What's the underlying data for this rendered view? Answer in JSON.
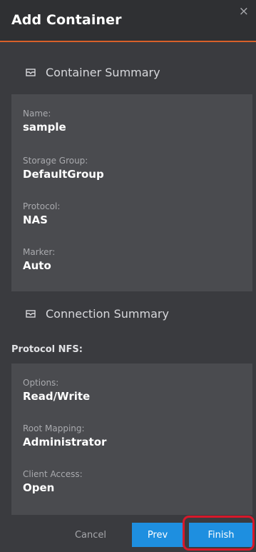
{
  "dialog": {
    "title": "Add Container",
    "close_symbol": "×"
  },
  "container_summary": {
    "heading": "Container Summary",
    "icon": "envelope-icon",
    "fields": [
      {
        "label": "Name:",
        "value": "sample"
      },
      {
        "label": "Storage Group:",
        "value": "DefaultGroup"
      },
      {
        "label": "Protocol:",
        "value": "NAS"
      },
      {
        "label": "Marker:",
        "value": "Auto"
      }
    ]
  },
  "connection_summary": {
    "heading": "Connection Summary",
    "icon": "envelope-icon",
    "protocol_title": "Protocol NFS:",
    "fields": [
      {
        "label": "Options:",
        "value": "Read/Write"
      },
      {
        "label": "Root Mapping:",
        "value": "Administrator"
      },
      {
        "label": "Client Access:",
        "value": "Open"
      }
    ]
  },
  "footer": {
    "cancel_label": "Cancel",
    "prev_label": "Prev",
    "finish_label": "Finish"
  },
  "colors": {
    "accent": "#d8602a",
    "primary_button": "#1e8fe0",
    "highlight": "#d7182a"
  }
}
